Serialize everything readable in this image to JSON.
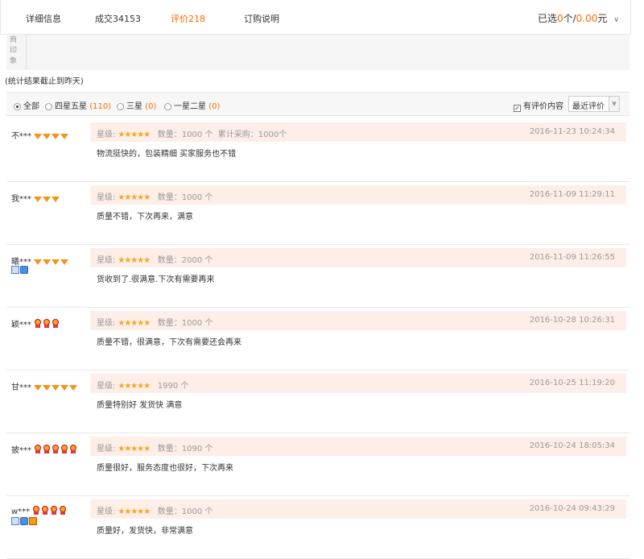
{
  "tabs": [
    {
      "label": "详细信息"
    },
    {
      "label": "成交34153"
    },
    {
      "label": "评价218"
    },
    {
      "label": "订购说明"
    }
  ],
  "cart": {
    "prefix": "已选",
    "count": "0",
    "unit": "个",
    "slash": "/",
    "amount": "0.00",
    "currency": "元"
  },
  "impression_label": "商印象",
  "note": "(统计结果截止到昨天)",
  "filters": [
    {
      "label": "全部",
      "count": ""
    },
    {
      "label": "四星五星",
      "count": "(110)"
    },
    {
      "label": "三星",
      "count": "(0)"
    },
    {
      "label": "一星二星",
      "count": "(0)"
    }
  ],
  "has_content_label": "有评价内容",
  "sort_label": "最近评价",
  "rating_label": "星级:",
  "stars": "★★★★★",
  "reviews": [
    {
      "user": "不***",
      "medal": "gem",
      "medal_count": 4,
      "qty": "数量：1000 个",
      "cumulative": "累计采购：1000个",
      "date": "2016-11-23 10:24:34",
      "text": "物流挺快的，包装精细 买家服务也不错"
    },
    {
      "user": "我***",
      "medal": "gem",
      "medal_count": 3,
      "qty": "数量：1000 个",
      "cumulative": "",
      "date": "2016-11-09 11:29:11",
      "text": "质量不错，下次再来，满意"
    },
    {
      "user": "曦***",
      "medal": "gem",
      "medal_count": 4,
      "qty": "数量：2000 个",
      "cumulative": "",
      "date": "2016-11-09 11:26:55",
      "text": "货收到了.很满意.下次有需要再来"
    },
    {
      "user": "颖***",
      "medal": "crown",
      "medal_count": 3,
      "qty": "数量：1000 个",
      "cumulative": "",
      "date": "2016-10-28 10:26:31",
      "text": "质量不错，很满意，下次有需要还会再来"
    },
    {
      "user": "甘***",
      "medal": "gem",
      "medal_count": 5,
      "qty": "1990 个",
      "cumulative": "",
      "date": "2016-10-25 11:19:20",
      "text": "质量特别好 发货快 满意"
    },
    {
      "user": "披***",
      "medal": "crown",
      "medal_count": 5,
      "qty": "数量：1090 个",
      "cumulative": "",
      "date": "2016-10-24 18:05:34",
      "text": "质量很好，服务态度也很好，下次再来"
    },
    {
      "user": "w***",
      "medal": "crown",
      "medal_count": 4,
      "qty": "数量：1000 个",
      "cumulative": "",
      "date": "2016-10-24 09:43:29",
      "text": "质量好，发货快，非常满意"
    }
  ],
  "colors": {
    "accent": "#ff6a00",
    "info_bg": "#fdeee8",
    "star": "#f5a623"
  }
}
